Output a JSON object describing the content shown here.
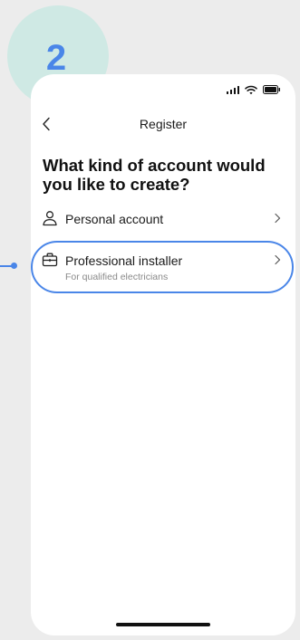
{
  "step_badge": {
    "number": "2",
    "background_color": "#cfe9e4",
    "number_color": "#4a86e8"
  },
  "status_bar": {
    "icons": [
      "signal-icon",
      "wifi-icon",
      "battery-icon"
    ]
  },
  "nav": {
    "back_icon": "chevron-left-icon",
    "title": "Register"
  },
  "page": {
    "heading": "What kind of account would you like to create?"
  },
  "options": [
    {
      "label": "Personal account",
      "icon": "user-icon",
      "chevron": "chevron-right-icon"
    },
    {
      "label": "Professional installer",
      "sublabel": "For qualified electricians",
      "icon": "briefcase-icon",
      "chevron": "chevron-right-icon",
      "highlighted": true
    }
  ],
  "annotation": {
    "highlight_color": "#4a86e8"
  }
}
